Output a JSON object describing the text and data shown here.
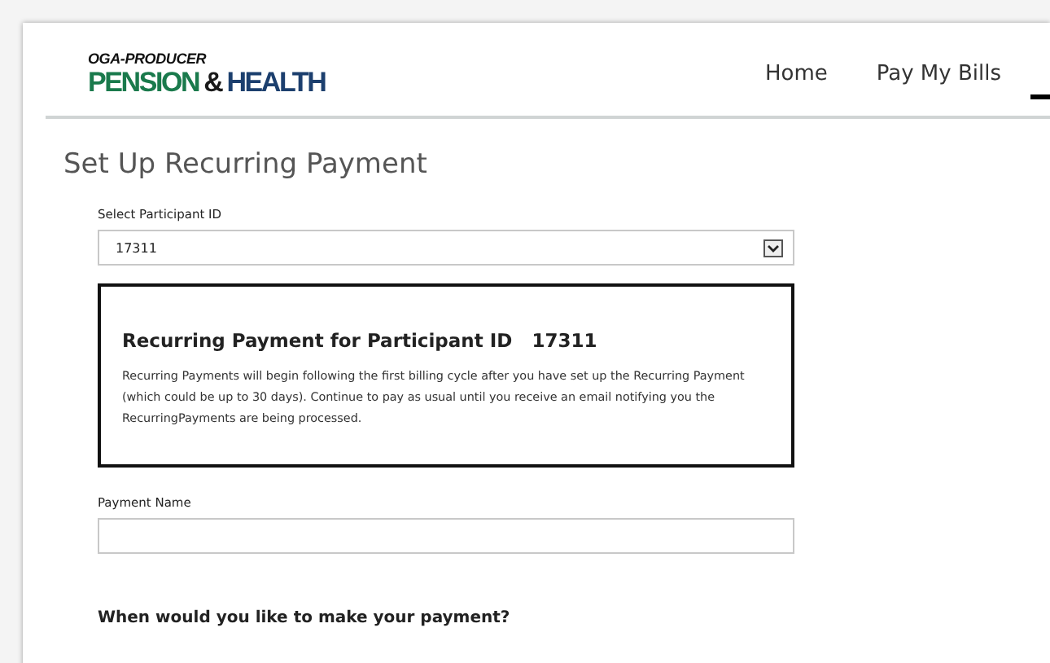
{
  "logo": {
    "tagline": "OGA-PRODUCER",
    "words": [
      {
        "text": "PENSION",
        "color": "#1a7a4c"
      },
      {
        "text": "&",
        "color": "#1a1a1a"
      },
      {
        "text": "HEALTH",
        "color": "#1c3f6e"
      }
    ]
  },
  "nav": [
    {
      "label": "Home"
    },
    {
      "label": "Pay My Bills"
    }
  ],
  "page_title": "Set Up Recurring Payment",
  "participant_select": {
    "label": "Select Participant ID",
    "value": "17311"
  },
  "info_box": {
    "heading": "Recurring Payment for Participant ID",
    "participant_id": "17311",
    "text": "Recurring Payments will begin following the first billing cycle after you have set up the Recurring Payment (which could be up to 30 days). Continue to pay as usual until you receive an email notifying you the RecurringPayments are being processed."
  },
  "payment_name": {
    "label": "Payment Name"
  },
  "question": "When would you like to make your payment?"
}
